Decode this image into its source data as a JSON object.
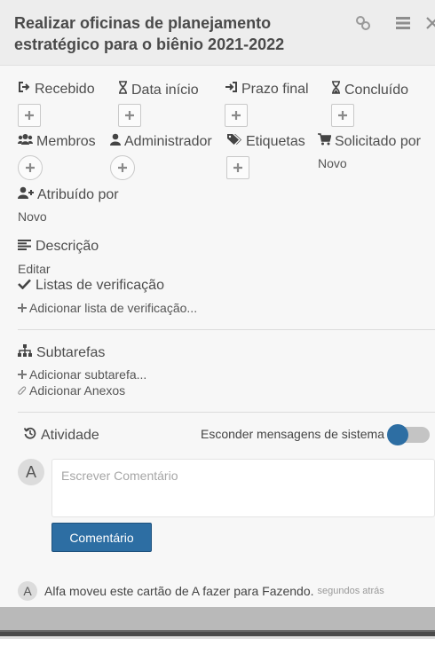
{
  "card": {
    "title": "Realizar oficinas de planejamento estratégico para o biênio 2021-2022",
    "icons": [
      "link-icon",
      "hamburger-menu-icon",
      "close-icon"
    ]
  },
  "fields": {
    "recebido": "Recebido",
    "data_inicio": "Data início",
    "prazo_final": "Prazo final",
    "concluido": "Concluído",
    "membros": "Membros",
    "administrador": "Administrador",
    "etiquetas": "Etiquetas",
    "solicitado_por": "Solicitado por",
    "solicitado_por_value": "Novo",
    "atribuido_por": "Atribuído por",
    "atribuido_por_value": "Novo"
  },
  "descricao": {
    "label": "Descrição",
    "edit": "Editar"
  },
  "checklists": {
    "label": "Listas de verificação",
    "add": "Adicionar lista de verificação..."
  },
  "subtarefas": {
    "label": "Subtarefas",
    "add": "Adicionar subtarefa..."
  },
  "anexos": {
    "add": "Adicionar Anexos"
  },
  "atividade": {
    "label": "Atividade",
    "toggle_label": "Esconder mensagens de sistema",
    "toggle_on": true
  },
  "comment": {
    "avatar": "A",
    "placeholder": "Escrever Comentário",
    "button": "Comentário"
  },
  "activity_items": [
    {
      "avatar": "A",
      "text": "Alfa moveu este cartão de A fazer para Fazendo.",
      "time": "segundos atrás"
    }
  ]
}
